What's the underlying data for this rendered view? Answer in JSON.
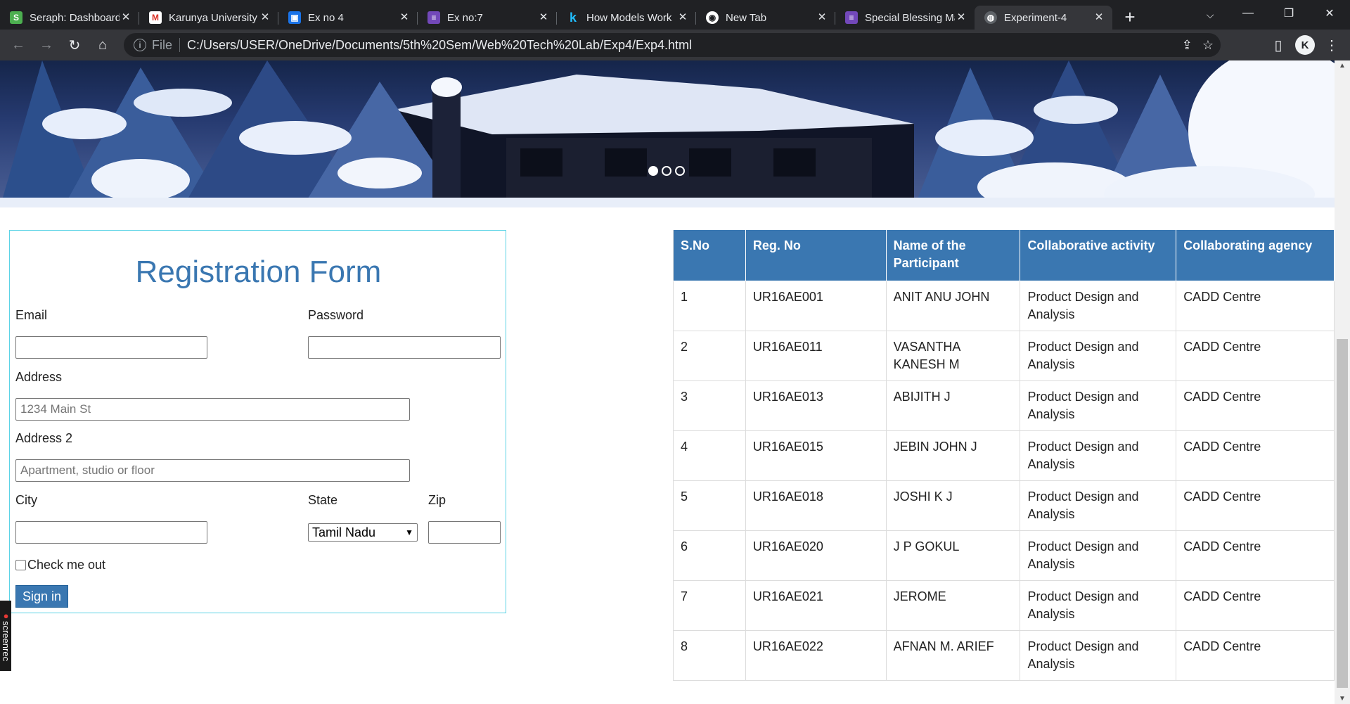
{
  "browser": {
    "tabs": [
      {
        "title": "Seraph: Dashboard",
        "icon": "seraph-icon",
        "active": false
      },
      {
        "title": "Karunya University",
        "icon": "gmail-icon",
        "active": false
      },
      {
        "title": "Ex no 4",
        "icon": "classroom-icon",
        "active": false
      },
      {
        "title": "Ex no:7",
        "icon": "forms-icon",
        "active": false
      },
      {
        "title": "How Models Work",
        "icon": "kaggle-icon",
        "active": false
      },
      {
        "title": "New Tab",
        "icon": "chrome-icon",
        "active": false
      },
      {
        "title": "Special Blessing Mass",
        "icon": "forms-icon",
        "active": false
      },
      {
        "title": "Experiment-4",
        "icon": "globe-icon",
        "active": true
      }
    ],
    "address": {
      "scheme": "File",
      "url": "C:/Users/USER/OneDrive/Documents/5th%20Sem/Web%20Tech%20Lab/Exp4/Exp4.html"
    },
    "profile_initial": "K"
  },
  "carousel": {
    "slides": 3,
    "active_slide": 1
  },
  "form": {
    "title": "Registration Form",
    "email_label": "Email",
    "email_value": "",
    "password_label": "Password",
    "password_value": "",
    "address_label": "Address",
    "address_placeholder": "1234 Main St",
    "address2_label": "Address 2",
    "address2_placeholder": "Apartment, studio or floor",
    "city_label": "City",
    "city_value": "",
    "state_label": "State",
    "state_selected": "Tamil Nadu",
    "zip_label": "Zip",
    "zip_value": "",
    "checkbox_label": "Check me out",
    "checkbox_checked": false,
    "submit_label": "Sign in"
  },
  "table": {
    "headers": [
      "S.No",
      "Reg. No",
      "Name of the Participant",
      "Collaborative activity",
      "Collaborating agency"
    ],
    "rows": [
      [
        "1",
        "UR16AE001",
        "ANIT ANU JOHN",
        "Product Design and Analysis",
        "CADD Centre"
      ],
      [
        "2",
        "UR16AE011",
        "VASANTHA KANESH M",
        "Product Design and Analysis",
        "CADD Centre"
      ],
      [
        "3",
        "UR16AE013",
        "ABIJITH J",
        "Product Design and Analysis",
        "CADD Centre"
      ],
      [
        "4",
        "UR16AE015",
        "JEBIN JOHN J",
        "Product Design and Analysis",
        "CADD Centre"
      ],
      [
        "5",
        "UR16AE018",
        "JOSHI K J",
        "Product Design and Analysis",
        "CADD Centre"
      ],
      [
        "6",
        "UR16AE020",
        "J P GOKUL",
        "Product Design and Analysis",
        "CADD Centre"
      ],
      [
        "7",
        "UR16AE021",
        "JEROME",
        "Product Design and Analysis",
        "CADD Centre"
      ],
      [
        "8",
        "UR16AE022",
        "AFNAN M. ARIEF",
        "Product Design and Analysis",
        "CADD Centre"
      ]
    ]
  },
  "overlay": {
    "screenrec_label": "screenrec"
  },
  "colors": {
    "primary": "#3a77b1",
    "form_border": "#5bd3e6",
    "chrome_dark": "#202124",
    "chrome_mid": "#35363a"
  }
}
